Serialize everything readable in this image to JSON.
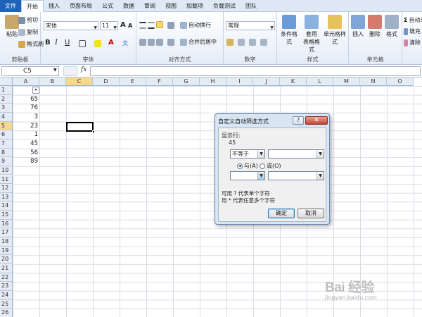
{
  "tabs": [
    "文件",
    "开始",
    "插入",
    "页面布局",
    "公式",
    "数据",
    "审阅",
    "视图",
    "加载项",
    "负载测试",
    "团队"
  ],
  "active_tab": "开始",
  "ribbon": {
    "clipboard": {
      "paste": "粘贴",
      "cut": "剪切",
      "copy": "复制",
      "format_painter": "格式刷",
      "label": "剪贴板"
    },
    "font": {
      "name": "宋体",
      "size": "11",
      "bold": "B",
      "italic": "I",
      "underline": "U",
      "label": "字体",
      "grow": "A",
      "shrink": "A",
      "phonetic": "文"
    },
    "alignment": {
      "wrap": "自动换行",
      "merge": "合并后居中",
      "label": "对齐方式"
    },
    "number": {
      "format": "常规",
      "label": "数字"
    },
    "styles": {
      "conditional": "条件格式",
      "table_line1": "套用",
      "table_line2": "表格格式",
      "cell_styles": "单元格样式",
      "label": "样式"
    },
    "cells": {
      "insert": "插入",
      "delete": "删除",
      "format": "格式",
      "label": "单元格"
    },
    "editing": {
      "autosum": "自动求",
      "fill": "填充",
      "clear": "清除"
    }
  },
  "formula_bar": {
    "name_box": "C5",
    "fx": "fx"
  },
  "columns": [
    "A",
    "B",
    "C",
    "D",
    "E",
    "F",
    "G",
    "H",
    "I",
    "J",
    "K",
    "L",
    "M",
    "N",
    "O"
  ],
  "selected_column": "C",
  "selected_row": "5",
  "rows": [
    "1",
    "2",
    "3",
    "4",
    "5",
    "6",
    "7",
    "8",
    "9",
    "10",
    "11",
    "12",
    "13",
    "14",
    "15",
    "16",
    "17",
    "18",
    "19",
    "20",
    "21",
    "22",
    "23",
    "24",
    "25",
    "26"
  ],
  "column_a_values": [
    "",
    "65",
    "76",
    "3",
    "23",
    "1",
    "45",
    "56",
    "89"
  ],
  "filter_arrow": "▾",
  "dialog": {
    "title": "自定义自动筛选方式",
    "help": "?",
    "close": "✕",
    "show_rows_label": "显示行:",
    "field_name": "45",
    "operator1": "不等于",
    "value1": "",
    "and_label": "与(A)",
    "or_label": "或(O)",
    "operator2": "",
    "value2": "",
    "hint1": "可用 ? 代表单个字符",
    "hint2": "用 * 代表任意多个字符",
    "ok": "确定",
    "cancel": "取消"
  },
  "watermark": {
    "brand": "Bai 经验",
    "url": "jingyan.baidu.com"
  },
  "colors": {
    "file_tab": "#1f63b8",
    "header_selected": "#f7d88d",
    "grid_line": "#d7dde6",
    "dialog_frame": "#d9e5f3",
    "close_button": "#c4432f"
  }
}
